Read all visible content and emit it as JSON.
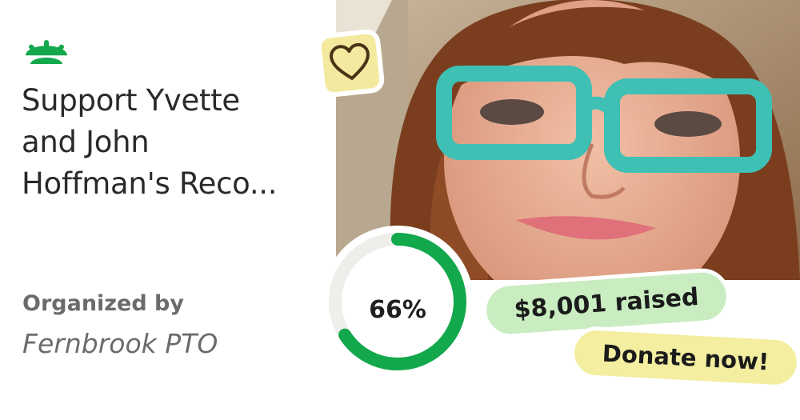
{
  "campaign": {
    "title": "Support Yvette\nand John\nHoffman's Reco...",
    "organized_label": "Organized by",
    "organizer": "Fernbrook PTO",
    "progress_text": "66%",
    "progress_fraction": 0.66,
    "raised_text": "$8,001 raised",
    "donate_label": "Donate now!"
  },
  "icons": {
    "logo": "sunrise-logo-icon",
    "heart": "heart-icon"
  },
  "colors": {
    "brand_green": "#12a84b",
    "ring_track": "#eeeeea",
    "raised_bg": "#c9ecc0",
    "donate_bg": "#f3eea0",
    "heart_badge_bg": "#f3eaa0",
    "text_dark": "#2a2a2a",
    "text_muted": "#6b6b6b"
  }
}
